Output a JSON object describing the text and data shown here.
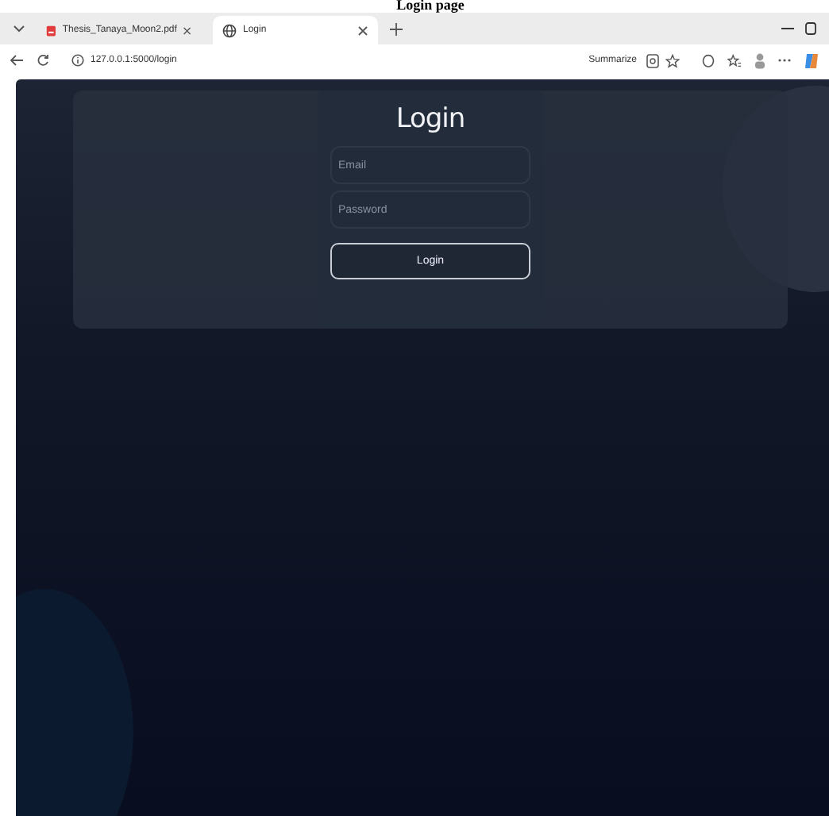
{
  "caption": "Login page",
  "browser": {
    "tabs": [
      {
        "title": "Thesis_Tanaya_Moon2.pdf",
        "kind": "pdf",
        "selected": false
      },
      {
        "title": "Login",
        "kind": "web",
        "selected": true
      }
    ],
    "url": "127.0.0.1:5000/login",
    "summarize": "Summarize"
  },
  "login": {
    "title": "Login",
    "fields": [
      {
        "placeholder": "Email"
      },
      {
        "placeholder": "Password"
      }
    ],
    "button": "Login"
  }
}
